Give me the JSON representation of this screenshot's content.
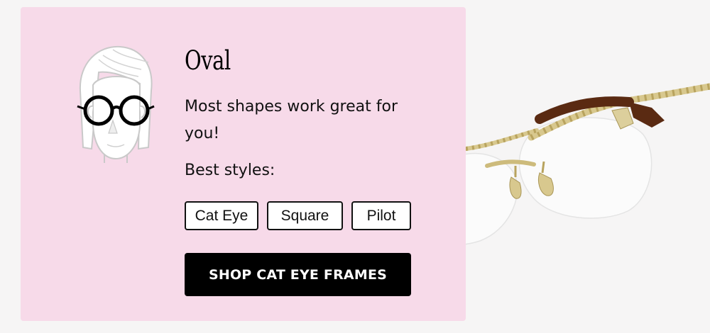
{
  "card": {
    "title": "Oval",
    "description": "Most shapes work great for you!",
    "best_styles_label": "Best styles:",
    "styles": [
      "Cat Eye",
      "Square",
      "Pilot"
    ],
    "cta_label": "SHOP CAT EYE FRAMES"
  },
  "colors": {
    "card_background": "#f7dae9",
    "page_background": "#f6f5f5",
    "button_background": "#000000",
    "button_text": "#ffffff",
    "frame_gold": "#d8c88e",
    "temple_tortoise": "#5a2a12"
  },
  "icons": {
    "face": "oval-face-illustration-icon",
    "product": "rimless-gold-glasses-image"
  }
}
